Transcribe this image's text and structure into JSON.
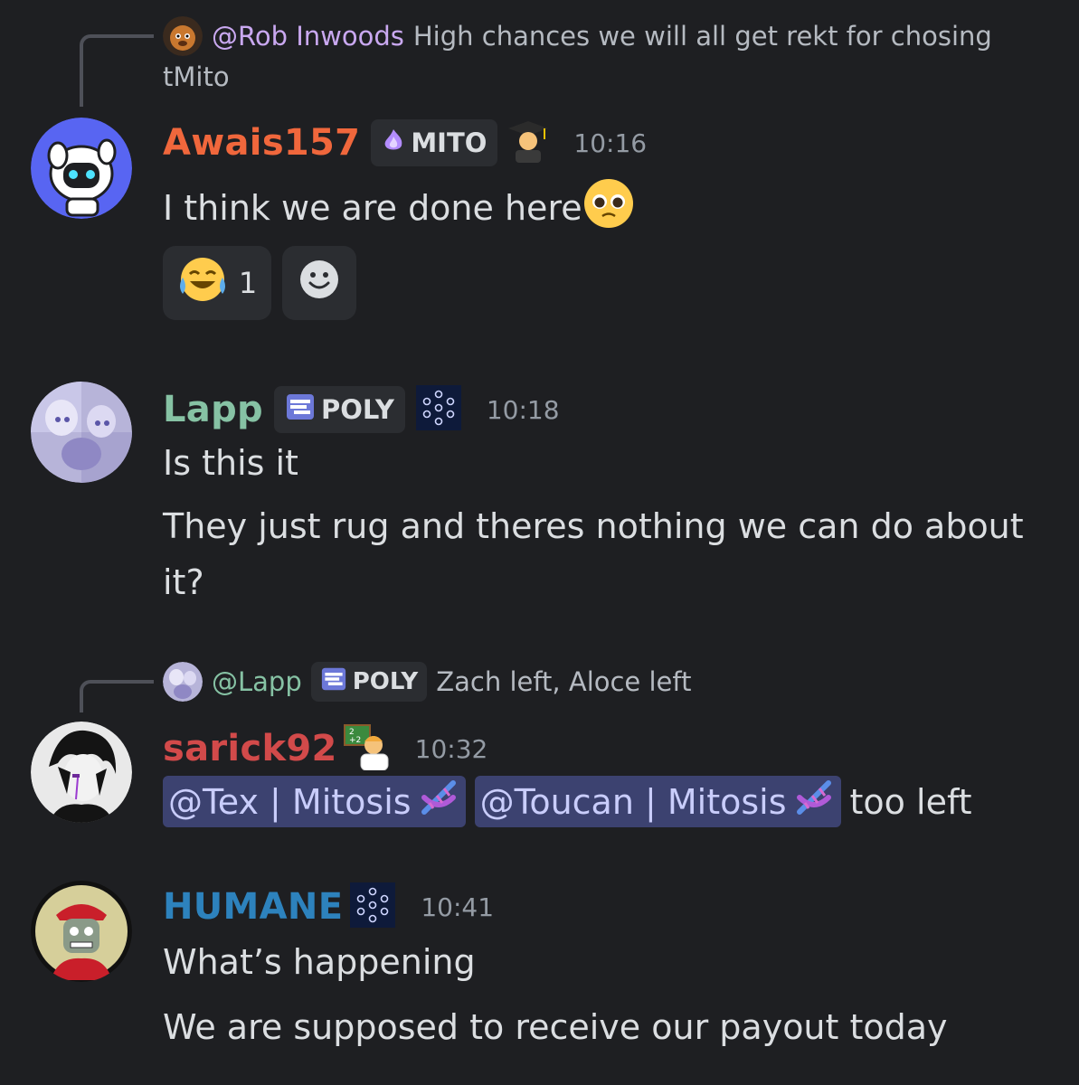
{
  "messages": [
    {
      "reply": {
        "mention": "@Rob Inwoods",
        "text": "High chances we will all get rekt for chosing",
        "text_wrap": "tMito"
      },
      "username": "Awais157",
      "username_color": "#f0673c",
      "tag": "MITO",
      "time": "10:16",
      "lines": [
        "I think we are done here"
      ],
      "reactions": [
        {
          "emoji": "joy",
          "count": "1"
        },
        {
          "emoji": "add-reaction"
        }
      ]
    },
    {
      "username": "Lapp",
      "username_color": "#86c2a4",
      "tag": "POLY",
      "time": "10:18",
      "lines": [
        "Is this it",
        "They just rug and theres nothing we can do about",
        "it?"
      ]
    },
    {
      "reply": {
        "mention": "@Lapp",
        "tag": "POLY",
        "text": "Zach left, Aloce left"
      },
      "username": "sarick92",
      "username_color": "#d24a4a",
      "time": "10:32",
      "mentions": [
        "@Tex | Mitosis",
        "@Toucan | Mitosis"
      ],
      "trailing": "too left"
    },
    {
      "username": "HUMANE",
      "username_color": "#2d82bd",
      "time": "10:41",
      "lines": [
        "What’s happening",
        "We are supposed to receive our payout today"
      ]
    }
  ],
  "colors": {
    "background": "#1e1f22",
    "tag_bg": "#2b2d31",
    "mention_bg": "#3c4270"
  },
  "icons": [
    "mito-flame-icon",
    "graduate-emoji-icon",
    "pleading-face-icon",
    "joy-emoji-icon",
    "add-reaction-icon",
    "poly-icon",
    "hex-network-icon",
    "teacher-emoji-icon",
    "dna-icon"
  ]
}
